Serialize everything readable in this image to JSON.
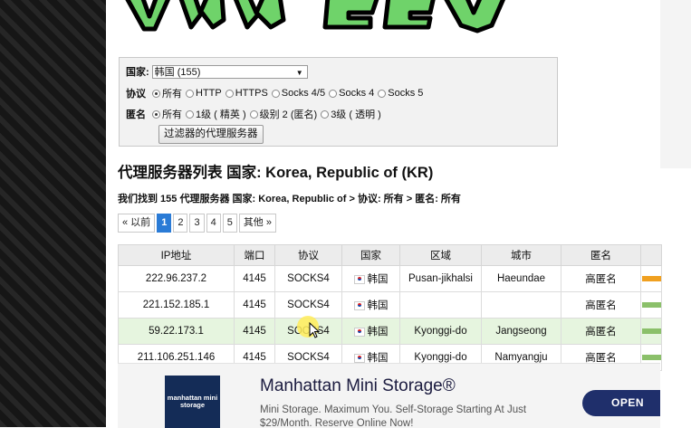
{
  "filter": {
    "country_label": "国家:",
    "country_value": "韩国 (155)",
    "protocol_label": "协议",
    "protocols": [
      "所有",
      "HTTP",
      "HTTPS",
      "Socks 4/5",
      "Socks 4",
      "Socks 5"
    ],
    "anon_label": "匿名",
    "anon_levels": [
      "所有",
      "1级 ( 精英 )",
      "级别 2 (匿名)",
      "3级 ( 透明 )"
    ],
    "submit_label": "过滤器的代理服务器"
  },
  "list_title": "代理服务器列表 国家: Korea, Republic of (KR)",
  "found_text": "我们找到 155 代理服务器 国家: Korea, Republic of > 协议: 所有 > 匿名: 所有",
  "pagination": {
    "prev": "« 以前",
    "pages": [
      "1",
      "2",
      "3",
      "4",
      "5"
    ],
    "more": "其他 »",
    "active": "1"
  },
  "table": {
    "headers": [
      "IP地址",
      "端口",
      "协议",
      "国家",
      "区域",
      "城市",
      "匿名"
    ],
    "rows": [
      {
        "ip": "222.96.237.2",
        "port": "4145",
        "protocol": "SOCKS4",
        "country": "韩国",
        "region": "Pusan-jikhalsi",
        "city": "Haeundae",
        "anon": "高匿名",
        "speed_color": "#f0a020"
      },
      {
        "ip": "221.152.185.1",
        "port": "4145",
        "protocol": "SOCKS4",
        "country": "韩国",
        "region": "",
        "city": "",
        "anon": "高匿名",
        "speed_color": "#8bc06a"
      },
      {
        "ip": "59.22.173.1",
        "port": "4145",
        "protocol": "SOCKS4",
        "country": "韩国",
        "region": "Kyonggi-do",
        "city": "Jangseong",
        "anon": "高匿名",
        "speed_color": "#8bc06a"
      },
      {
        "ip": "211.106.251.146",
        "port": "4145",
        "protocol": "SOCKS4",
        "country": "韩国",
        "region": "Kyonggi-do",
        "city": "Namyangju",
        "anon": "高匿名",
        "speed_color": "#8bc06a"
      }
    ]
  },
  "ad": {
    "logo": "manhattan mini storage",
    "title": "Manhattan Mini Storage®",
    "desc": "Mini Storage. Maximum You. Self-Storage Starting At Just $29/Month. Reserve Online Now!",
    "button": "OPEN"
  },
  "colors": {
    "banner_green": "#6fd36a",
    "active_page": "#2a7bd6",
    "highlight_row": "#e6f5df",
    "ad_button": "#1f2f6b"
  }
}
